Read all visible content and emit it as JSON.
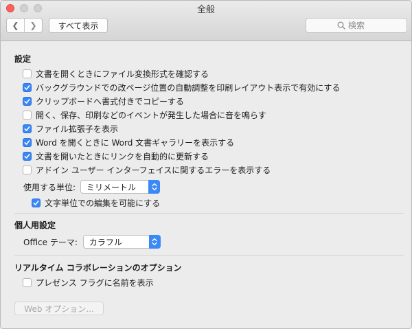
{
  "window": {
    "title": "全般"
  },
  "toolbar": {
    "back_glyph": "❮",
    "forward_glyph": "❯",
    "show_all_label": "すべて表示",
    "search_placeholder": "検索"
  },
  "sections": {
    "settings": {
      "title": "設定",
      "options": [
        {
          "label": "文書を開くときにファイル変換形式を確認する",
          "checked": false
        },
        {
          "label": "バックグラウンドでの改ページ位置の自動調整を印刷レイアウト表示で有効にする",
          "checked": true
        },
        {
          "label": "クリップボードへ書式付きでコピーする",
          "checked": true
        },
        {
          "label": "開く、保存、印刷などのイベントが発生した場合に音を鳴らす",
          "checked": false
        },
        {
          "label": "ファイル拡張子を表示",
          "checked": true
        },
        {
          "label": "Word を開くときに Word 文書ギャラリーを表示する",
          "checked": true
        },
        {
          "label": "文書を開いたときにリンクを自動的に更新する",
          "checked": true
        },
        {
          "label": "アドイン ユーザー インターフェイスに関するエラーを表示する",
          "checked": false
        }
      ],
      "units_label": "使用する単位:",
      "units_value": "ミリメートル",
      "char_units_label": "文字単位での編集を可能にする",
      "char_units_checked": true
    },
    "personal": {
      "title": "個人用設定",
      "theme_label": "Office テーマ:",
      "theme_value": "カラフル"
    },
    "realtime": {
      "title": "リアルタイム コラボレーションのオプション",
      "presence_label": "プレゼンス フラグに名前を表示",
      "presence_checked": false
    }
  },
  "web_options_label": "Web オプション..."
}
